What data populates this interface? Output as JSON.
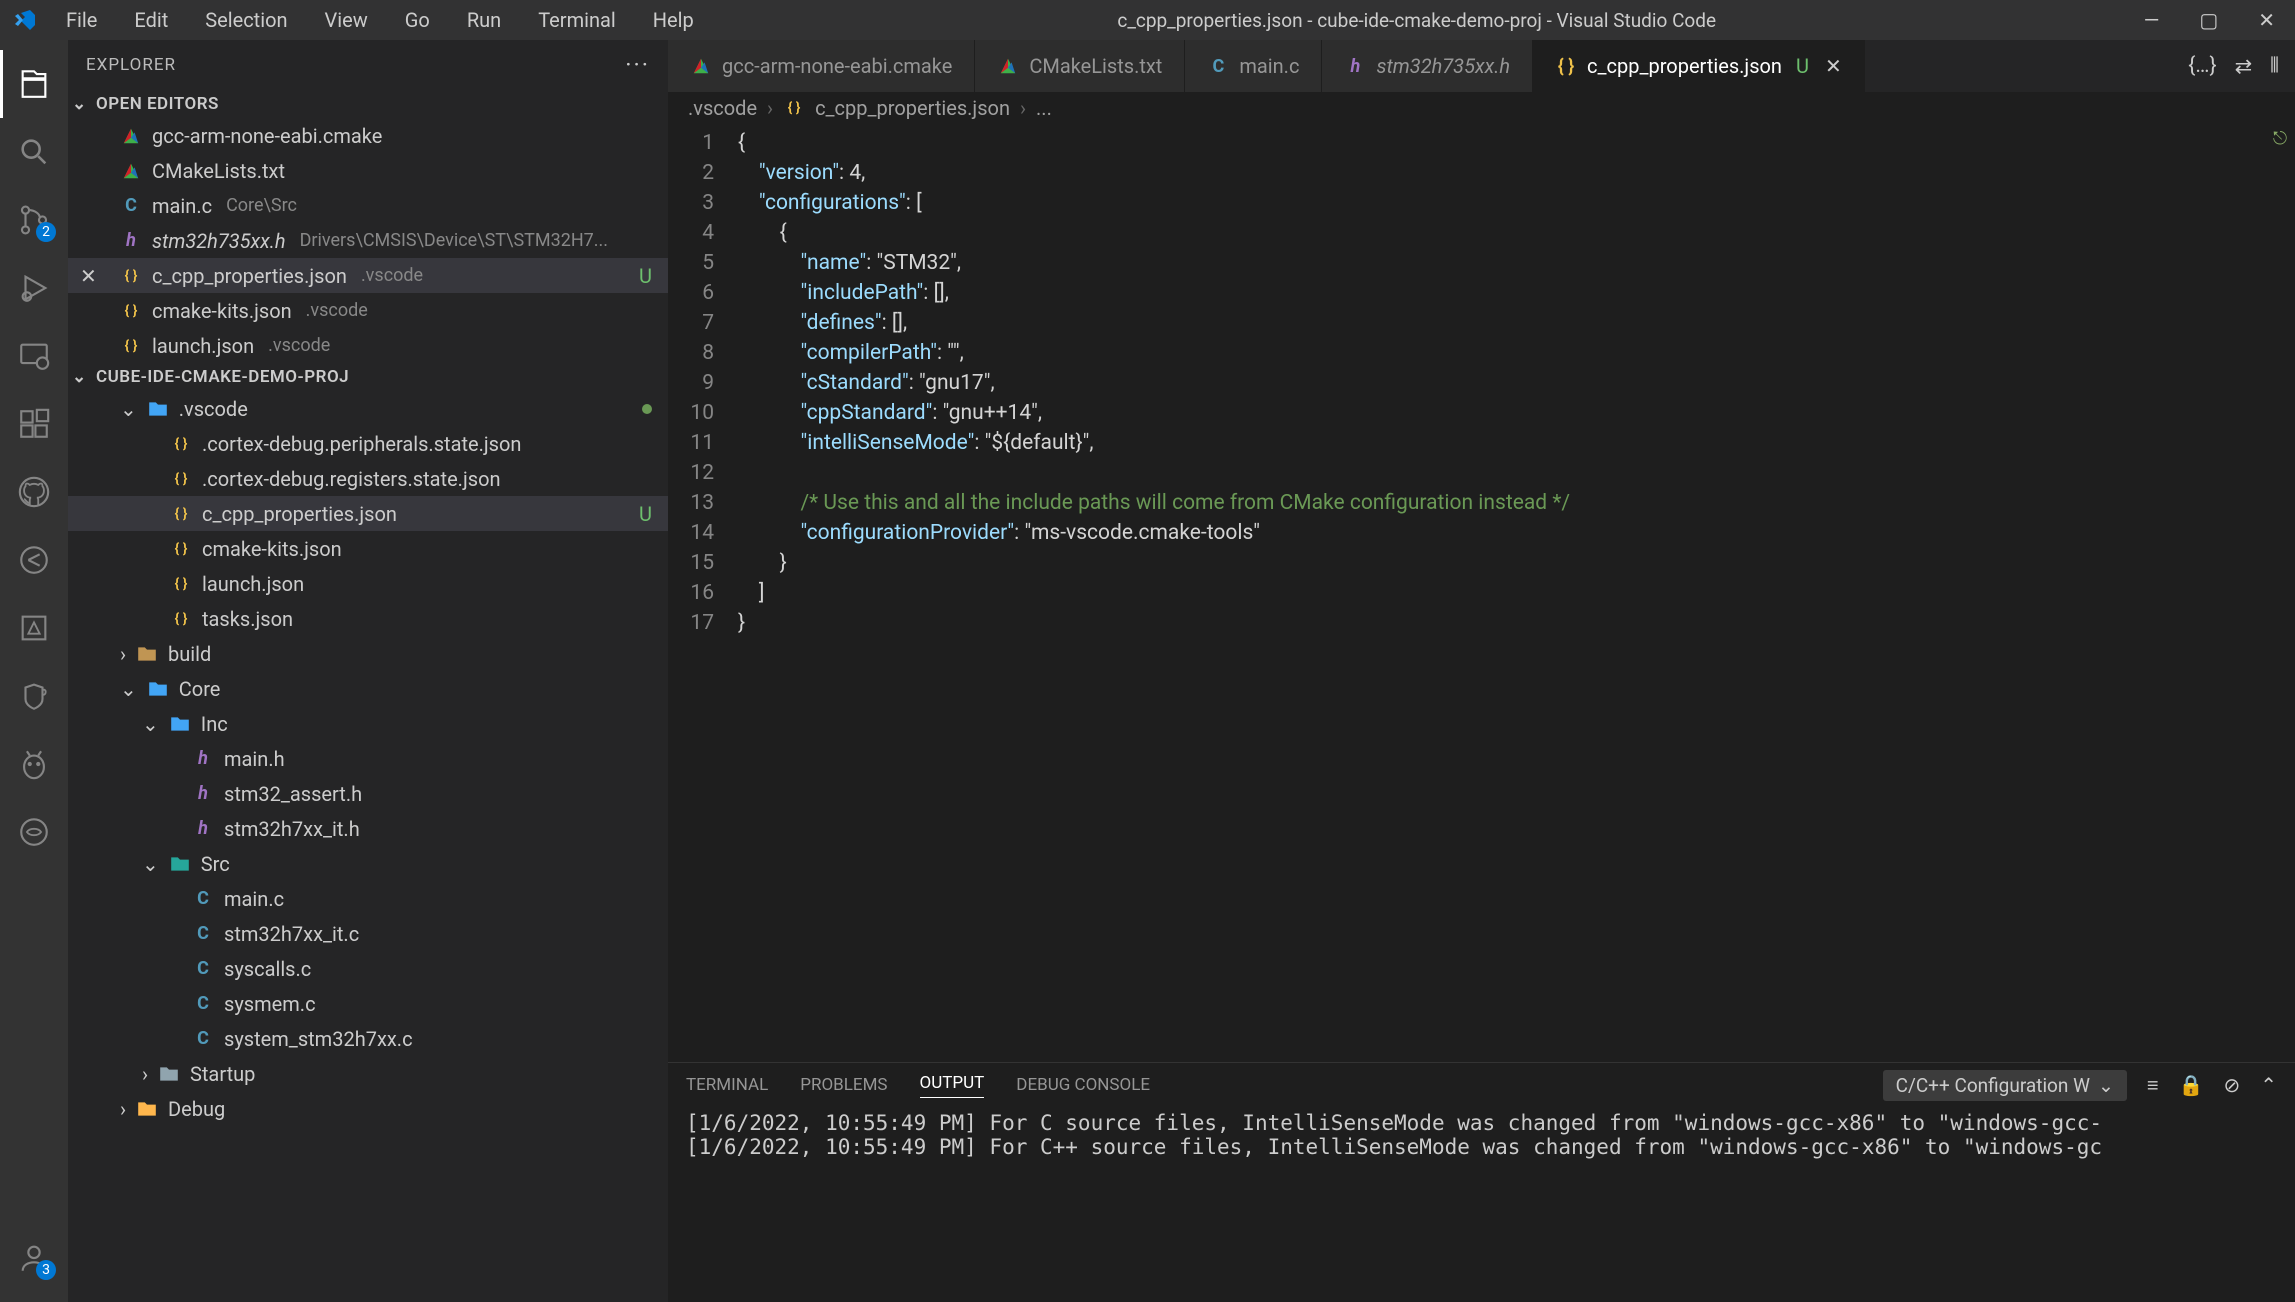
{
  "title": "c_cpp_properties.json - cube-ide-cmake-demo-proj - Visual Studio Code",
  "menu": [
    "File",
    "Edit",
    "Selection",
    "View",
    "Go",
    "Run",
    "Terminal",
    "Help"
  ],
  "activity_badges": {
    "scm": "2",
    "accounts": "3"
  },
  "sidebar": {
    "title": "EXPLORER",
    "openEditorsHeader": "OPEN EDITORS",
    "openEditors": [
      {
        "icon": "cmake",
        "name": "gcc-arm-none-eabi.cmake",
        "path": ""
      },
      {
        "icon": "cmake",
        "name": "CMakeLists.txt",
        "path": ""
      },
      {
        "icon": "c",
        "name": "main.c",
        "path": "Core\\Src"
      },
      {
        "icon": "h",
        "name": "stm32h735xx.h",
        "path": "Drivers\\CMSIS\\Device\\ST\\STM32H7...",
        "italic": true
      },
      {
        "icon": "json",
        "name": "c_cpp_properties.json",
        "path": ".vscode",
        "status": "U",
        "close": true,
        "selected": true
      },
      {
        "icon": "json",
        "name": "cmake-kits.json",
        "path": ".vscode"
      },
      {
        "icon": "json",
        "name": "launch.json",
        "path": ".vscode"
      }
    ],
    "projectHeader": "CUBE-IDE-CMAKE-DEMO-PROJ",
    "tree": [
      {
        "type": "folder",
        "icon": "folder-vs",
        "name": ".vscode",
        "indent": 1,
        "expanded": true,
        "dot": true
      },
      {
        "type": "file",
        "icon": "json",
        "name": ".cortex-debug.peripherals.state.json",
        "indent": 2
      },
      {
        "type": "file",
        "icon": "json",
        "name": ".cortex-debug.registers.state.json",
        "indent": 2
      },
      {
        "type": "file",
        "icon": "json",
        "name": "c_cpp_properties.json",
        "indent": 2,
        "status": "U",
        "selected": true
      },
      {
        "type": "file",
        "icon": "json",
        "name": "cmake-kits.json",
        "indent": 2
      },
      {
        "type": "file",
        "icon": "json",
        "name": "launch.json",
        "indent": 2
      },
      {
        "type": "file",
        "icon": "json",
        "name": "tasks.json",
        "indent": 2
      },
      {
        "type": "folder",
        "icon": "folder",
        "name": "build",
        "indent": 1,
        "expanded": false
      },
      {
        "type": "folder",
        "icon": "folder-core",
        "name": "Core",
        "indent": 1,
        "expanded": true
      },
      {
        "type": "folder",
        "icon": "folder-vs",
        "name": "Inc",
        "indent": 2,
        "expanded": true
      },
      {
        "type": "file",
        "icon": "h",
        "name": "main.h",
        "indent": 3
      },
      {
        "type": "file",
        "icon": "h",
        "name": "stm32_assert.h",
        "indent": 3
      },
      {
        "type": "file",
        "icon": "h",
        "name": "stm32h7xx_it.h",
        "indent": 3
      },
      {
        "type": "folder",
        "icon": "folder-src",
        "name": "Src",
        "indent": 2,
        "expanded": true
      },
      {
        "type": "file",
        "icon": "c",
        "name": "main.c",
        "indent": 3
      },
      {
        "type": "file",
        "icon": "c",
        "name": "stm32h7xx_it.c",
        "indent": 3
      },
      {
        "type": "file",
        "icon": "c",
        "name": "syscalls.c",
        "indent": 3
      },
      {
        "type": "file",
        "icon": "c",
        "name": "sysmem.c",
        "indent": 3
      },
      {
        "type": "file",
        "icon": "c",
        "name": "system_stm32h7xx.c",
        "indent": 3
      },
      {
        "type": "folder",
        "icon": "folder-grey",
        "name": "Startup",
        "indent": 2,
        "expanded": false
      },
      {
        "type": "folder",
        "icon": "folder-debug",
        "name": "Debug",
        "indent": 1,
        "expanded": false
      }
    ]
  },
  "tabs": [
    {
      "icon": "cmake",
      "label": "gcc-arm-none-eabi.cmake"
    },
    {
      "icon": "cmake",
      "label": "CMakeLists.txt"
    },
    {
      "icon": "c",
      "label": "main.c"
    },
    {
      "icon": "h",
      "label": "stm32h735xx.h",
      "italic": true
    },
    {
      "icon": "json",
      "label": "c_cpp_properties.json",
      "status": "U",
      "active": true
    }
  ],
  "breadcrumb": [
    ".vscode",
    "c_cpp_properties.json",
    "..."
  ],
  "code": {
    "lines": [
      "{",
      "    \"version\": 4,",
      "    \"configurations\": [",
      "        {",
      "            \"name\": \"STM32\",",
      "            \"includePath\": [],",
      "            \"defines\": [],",
      "            \"compilerPath\": \"\",",
      "            \"cStandard\": \"gnu17\",",
      "            \"cppStandard\": \"gnu++14\",",
      "            \"intelliSenseMode\": \"${default}\",",
      "",
      "            /* Use this and all the include paths will come from CMake configuration instead */",
      "            \"configurationProvider\": \"ms-vscode.cmake-tools\"",
      "        }",
      "    ]",
      "}"
    ]
  },
  "panel": {
    "tabs": [
      "TERMINAL",
      "PROBLEMS",
      "OUTPUT",
      "DEBUG CONSOLE"
    ],
    "activeTab": 2,
    "selector": "C/C++ Configuration W",
    "output": [
      "[1/6/2022, 10:55:49 PM] For C source files, IntelliSenseMode was changed from \"windows-gcc-x86\" to \"windows-gcc-",
      "[1/6/2022, 10:55:49 PM] For C++ source files, IntelliSenseMode was changed from \"windows-gcc-x86\" to \"windows-gc"
    ]
  }
}
